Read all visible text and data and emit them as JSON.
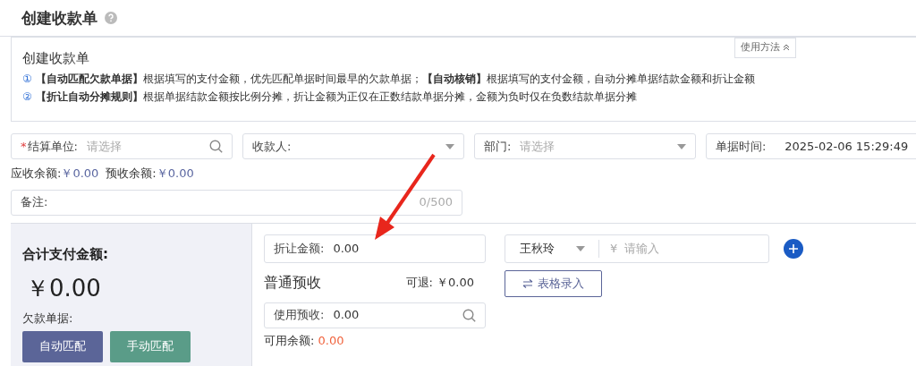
{
  "page": {
    "title": "创建收款单"
  },
  "info": {
    "title": "创建收款单",
    "toggle": "使用方法",
    "lines": [
      {
        "num": "①",
        "text": "**【自动匹配欠款单据】**根据填写的支付金额，优先匹配单据时间最早的欠款单据；**【自动核销】**根据填写的支付金额，自动分摊单据结款金额和折让金额"
      },
      {
        "num": "②",
        "text": "**【折让自动分摊规则】**根据单据结款金额按比例分摊，折让金额为正仅在正数结款单据分摊，金额为负时仅在负数结款单据分摊"
      }
    ]
  },
  "fields": [
    {
      "kind": "search",
      "required_mark": "*",
      "label": "结算单位:",
      "placeholder": "请选择"
    },
    {
      "kind": "select",
      "label": "收款人:"
    },
    {
      "kind": "select",
      "label": "部门:",
      "placeholder": "请选择"
    },
    {
      "kind": "date",
      "label": "单据时间:",
      "value": "2025-02-06 15:29:49"
    }
  ],
  "balances": [
    {
      "label": "应收余额:",
      "value": "￥0.00"
    },
    {
      "label": "预收余额:",
      "value": "￥0.00"
    }
  ],
  "remark": {
    "label": "备注:",
    "counter": "0/500"
  },
  "total": {
    "label": "合计支付金额:",
    "amount": "￥0.00",
    "debt_label": "欠款单据:",
    "buttons": [
      "自动匹配",
      "手动匹配"
    ]
  },
  "discount": {
    "label": "折让金额:",
    "value": "0.00"
  },
  "prepay": {
    "title": "普通预收",
    "refund_label": "可退:",
    "refund": "￥0.00",
    "use_label": "使用预收:",
    "use_value": "0.00",
    "avail_label": "可用余额:",
    "avail": "0.00"
  },
  "payment": {
    "payer": "王秋玲",
    "currency": "¥",
    "placeholder": "请输入",
    "table_button": "表格录入"
  }
}
